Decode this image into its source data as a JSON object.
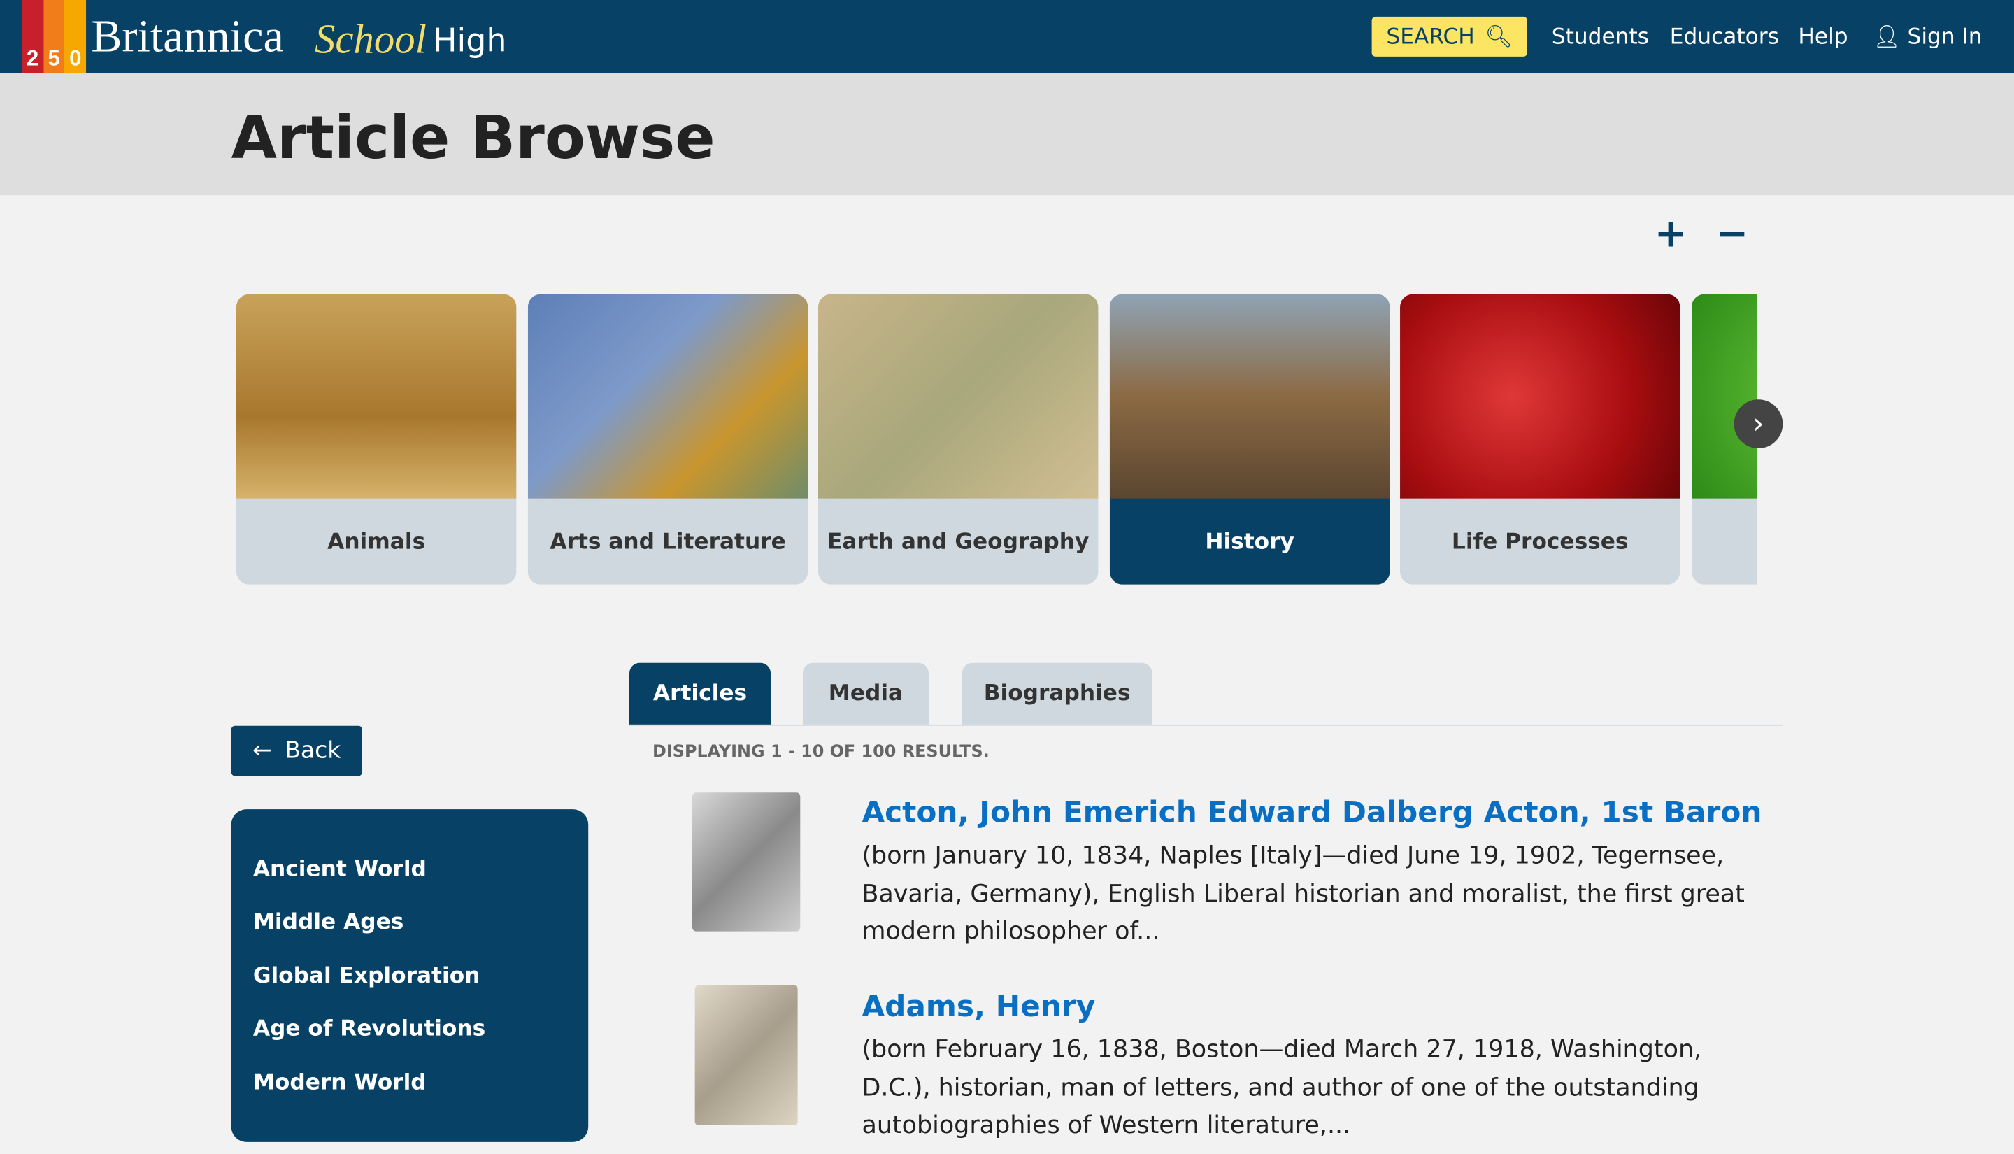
{
  "header": {
    "logo_number": "250",
    "brand": "Britannica",
    "brand_sub": "School",
    "level": "High",
    "search_label": "SEARCH",
    "nav": [
      "Students",
      "Educators",
      "Help",
      "Sign In"
    ]
  },
  "page": {
    "title": "Article Browse",
    "zoom_in": "+",
    "zoom_out": "−"
  },
  "categories": [
    {
      "label": "Animals",
      "selected": false
    },
    {
      "label": "Arts and Literature",
      "selected": false
    },
    {
      "label": "Earth and Geography",
      "selected": false
    },
    {
      "label": "History",
      "selected": true
    },
    {
      "label": "Life Processes",
      "selected": false
    }
  ],
  "tabs": [
    {
      "label": "Articles",
      "selected": true
    },
    {
      "label": "Media"
    },
    {
      "label": "Biographies"
    }
  ],
  "back_label": "Back",
  "sidebar": [
    "Ancient World",
    "Middle Ages",
    "Global Exploration",
    "Age of Revolutions",
    "Modern World"
  ],
  "results_summary": "DISPLAYING 1 - 10 OF 100 RESULTS.",
  "results": [
    {
      "title": "Acton, John Emerich Edward Dalberg Acton, 1st Baron",
      "desc": "(born January 10, 1834, Naples [Italy]—died June 19, 1902, Tegernsee, Bavaria, Germany), English Liberal historian and moralist, the first great modern philosopher of..."
    },
    {
      "title": "Adams, Henry",
      "desc": "(born February 16, 1838, Boston—died March 27, 1918, Washington, D.C.), historian, man of letters, and author of one of the outstanding autobiographies of Western literature,..."
    }
  ],
  "colors": {
    "primary": "#074266",
    "search": "#fce562",
    "link": "#0a6fc2"
  }
}
